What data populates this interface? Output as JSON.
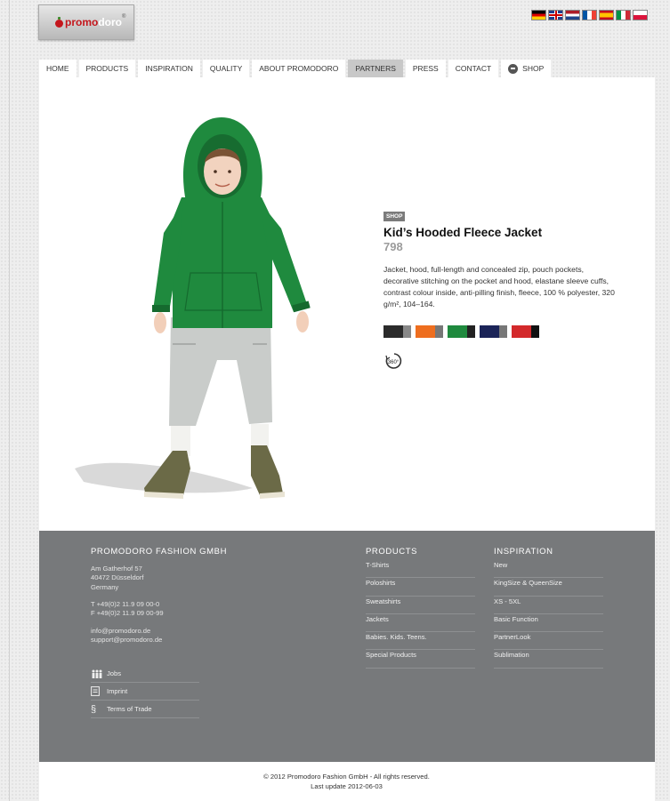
{
  "brand": {
    "logo_part1": "promo",
    "logo_part2": "doro",
    "logo_reg": "®"
  },
  "languages": [
    "de",
    "uk",
    "nl",
    "fr",
    "es",
    "it",
    "pl"
  ],
  "nav": [
    {
      "id": "home",
      "label": "HOME"
    },
    {
      "id": "products",
      "label": "PRODUCTS"
    },
    {
      "id": "inspiration",
      "label": "INSPIRATION"
    },
    {
      "id": "quality",
      "label": "QUALITY"
    },
    {
      "id": "about",
      "label": "ABOUT PROMODORO"
    },
    {
      "id": "partners",
      "label": "PARTNERS",
      "active": true
    },
    {
      "id": "press",
      "label": "PRESS"
    },
    {
      "id": "contact",
      "label": "CONTACT"
    },
    {
      "id": "shop",
      "label": "SHOP"
    }
  ],
  "product": {
    "badge": "SHOP",
    "title": "Kid’s Hooded Fleece Jacket",
    "number": "798",
    "description": "Jacket, hood, full-length and concealed zip, pouch pockets, decorative stitching on the pocket and hood, elastane sleeve cuffs, contrast colour inside, anti-pilling finish, fleece, 100 % polyester, 320 g/m², 104–164.",
    "rotate_label": "360°",
    "swatches": [
      {
        "name": "black-grey",
        "main": "#2b2b2b",
        "contrast": "#888888"
      },
      {
        "name": "orange-grey",
        "main": "#ee6e1f",
        "contrast": "#777777"
      },
      {
        "name": "green-black",
        "main": "#1f8a3e",
        "contrast": "#222222"
      },
      {
        "name": "navy-grey",
        "main": "#1b2458",
        "contrast": "#777777"
      },
      {
        "name": "red-black",
        "main": "#d3292b",
        "contrast": "#111111"
      }
    ]
  },
  "footer": {
    "company": {
      "heading": "PROMODORO FASHION GMBH",
      "address": [
        "Am Gatherhof 57",
        "40472 Düsseldorf",
        "Germany"
      ],
      "phone": [
        "T +49(0)2 11.9 09 00-0",
        "F +49(0)2 11.9 09 00-99"
      ],
      "email": [
        "info@promodoro.de",
        "support@promodoro.de"
      ]
    },
    "utility": [
      {
        "icon": "people-icon",
        "label": "Jobs"
      },
      {
        "icon": "document-icon",
        "label": "Imprint"
      },
      {
        "icon": "section-icon",
        "label": "Terms of Trade",
        "glyph": "§"
      }
    ],
    "products": {
      "heading": "PRODUCTS",
      "links": [
        "T-Shirts",
        "Poloshirts",
        "Sweatshirts",
        "Jackets",
        "Babies. Kids. Teens.",
        "Special Products"
      ]
    },
    "inspiration": {
      "heading": "INSPIRATION",
      "links": [
        "New",
        "KingSize & QueenSize",
        "XS - 5XL",
        "Basic Function",
        "PartnerLook",
        "Sublimation"
      ]
    }
  },
  "copyright": {
    "line1": "© 2012 Promodoro Fashion GmbH - All rights reserved.",
    "line2": "Last update 2012-06-03"
  },
  "colors": {
    "accent_red": "#c4161c",
    "footer_bg": "#77797b",
    "jacket_green": "#1f8a3e",
    "nav_active": "#c8c8c8"
  }
}
